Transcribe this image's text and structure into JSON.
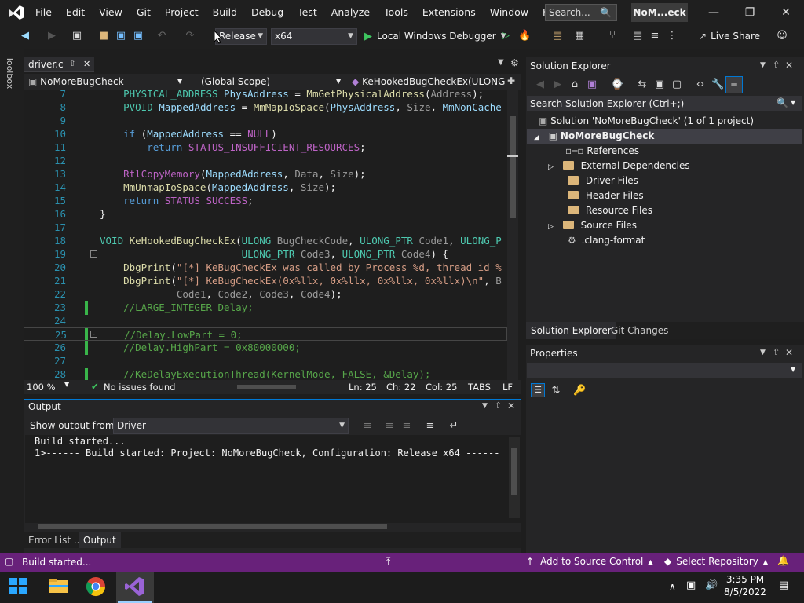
{
  "menu": [
    "File",
    "Edit",
    "View",
    "Git",
    "Project",
    "Build",
    "Debug",
    "Test",
    "Analyze",
    "Tools",
    "Extensions",
    "Window",
    "Help"
  ],
  "search": {
    "placeholder": "Search..."
  },
  "app_title": "NoM...eck",
  "toolbar": {
    "config": "Release",
    "platform": "x64",
    "debugger": "Local Windows Debugger",
    "live_share": "Live Share"
  },
  "toolbox_label": "Toolbox",
  "editor": {
    "tab": "driver.c",
    "nav_project": "NoMoreBugCheck",
    "nav_scope": "(Global Scope)",
    "nav_member": "KeHookedBugCheckEx(ULONG",
    "lines": [
      {
        "n": "7",
        "t": "    PHYSICAL_ADDRESS PhysAddress = MmGetPhysicalAddress(Address);"
      },
      {
        "n": "8",
        "t": "    PVOID MappedAddress = MmMapIoSpace(PhysAddress, Size, MmNonCache"
      },
      {
        "n": "9",
        "t": ""
      },
      {
        "n": "10",
        "t": "    if (MappedAddress == NULL)"
      },
      {
        "n": "11",
        "t": "        return STATUS_INSUFFICIENT_RESOURCES;"
      },
      {
        "n": "12",
        "t": ""
      },
      {
        "n": "13",
        "t": "    RtlCopyMemory(MappedAddress, Data, Size);"
      },
      {
        "n": "14",
        "t": "    MmUnmapIoSpace(MappedAddress, Size);"
      },
      {
        "n": "15",
        "t": "    return STATUS_SUCCESS;"
      },
      {
        "n": "16",
        "t": "}"
      },
      {
        "n": "17",
        "t": ""
      },
      {
        "n": "18",
        "t": "VOID KeHookedBugCheckEx(ULONG BugCheckCode, ULONG_PTR Code1, ULONG_P"
      },
      {
        "n": "19",
        "t": "                        ULONG_PTR Code3, ULONG_PTR Code4) {"
      },
      {
        "n": "20",
        "t": "    DbgPrint(\"[*] KeBugCheckEx was called by Process %d, thread id %"
      },
      {
        "n": "21",
        "t": "    DbgPrint(\"[*] KeBugCheckEx(0x%llx, 0x%llx, 0x%llx, 0x%llx)\\n\", B"
      },
      {
        "n": "22",
        "t": "             Code1, Code2, Code3, Code4);"
      },
      {
        "n": "23",
        "t": "    //LARGE_INTEGER Delay;"
      },
      {
        "n": "24",
        "t": ""
      },
      {
        "n": "25",
        "t": "    //Delay.LowPart = 0;"
      },
      {
        "n": "26",
        "t": "    //Delay.HighPart = 0x80000000;"
      },
      {
        "n": "27",
        "t": ""
      },
      {
        "n": "28",
        "t": "    //KeDelayExecutionThread(KernelMode, FALSE, &Delay);"
      }
    ],
    "zoom": "100 %",
    "issues": "No issues found",
    "ln": "Ln: 25",
    "ch": "Ch: 22",
    "col": "Col: 25",
    "tabs": "TABS",
    "eol": "LF"
  },
  "output": {
    "title": "Output",
    "show_from_label": "Show output from:",
    "source": "Driver",
    "lines": [
      "Build started...",
      "1>------ Build started: Project: NoMoreBugCheck, Configuration: Release x64 ------"
    ],
    "tabs": [
      "Error List ...",
      "Output"
    ]
  },
  "solution_explorer": {
    "title": "Solution Explorer",
    "search_placeholder": "Search Solution Explorer (Ctrl+;)",
    "solution": "Solution 'NoMoreBugCheck' (1 of 1 project)",
    "project": "NoMoreBugCheck",
    "items": [
      "References",
      "External Dependencies",
      "Driver Files",
      "Header Files",
      "Resource Files",
      "Source Files",
      ".clang-format"
    ],
    "tabs": [
      "Solution Explorer",
      "Git Changes"
    ]
  },
  "properties": {
    "title": "Properties"
  },
  "statusbar": {
    "message": "Build started...",
    "add_source": "Add to Source Control",
    "select_repo": "Select Repository"
  },
  "taskbar": {
    "time": "3:35 PM",
    "date": "8/5/2022"
  },
  "colors": {
    "accent": "#68217a",
    "keyword": "#569cd6",
    "function": "#dcdcaa",
    "comment": "#57a64a"
  }
}
